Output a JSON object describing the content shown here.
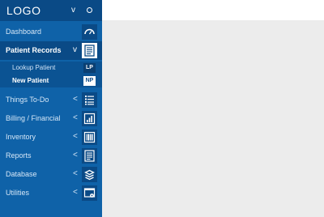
{
  "header": {
    "logo": "LOGO",
    "caret": "v",
    "circle": "o"
  },
  "menu": {
    "dashboard": {
      "label": "Dashboard",
      "icon": "speedometer-icon"
    },
    "patient_records": {
      "label": "Patient Records",
      "chev": "v",
      "icon": "records-icon",
      "sub": [
        {
          "label": "Lookup Patient",
          "tag": "LP"
        },
        {
          "label": "New Patient",
          "tag": "NP"
        }
      ]
    },
    "things_to_do": {
      "label": "Things To-Do",
      "chev": "<",
      "icon": "list-icon"
    },
    "billing": {
      "label": "Billing / Financial",
      "chev": "<",
      "icon": "bar-chart-icon"
    },
    "inventory": {
      "label": "Inventory",
      "chev": "<",
      "icon": "barcode-icon"
    },
    "reports": {
      "label": "Reports",
      "chev": "<",
      "icon": "report-icon"
    },
    "database": {
      "label": "Database",
      "chev": "<",
      "icon": "database-icon"
    },
    "utilities": {
      "label": "Utilities",
      "chev": "<",
      "icon": "settings-window-icon"
    }
  },
  "colors": {
    "sidebar": "#0f62a8",
    "header": "#0a4a86",
    "content": "#ececec"
  }
}
